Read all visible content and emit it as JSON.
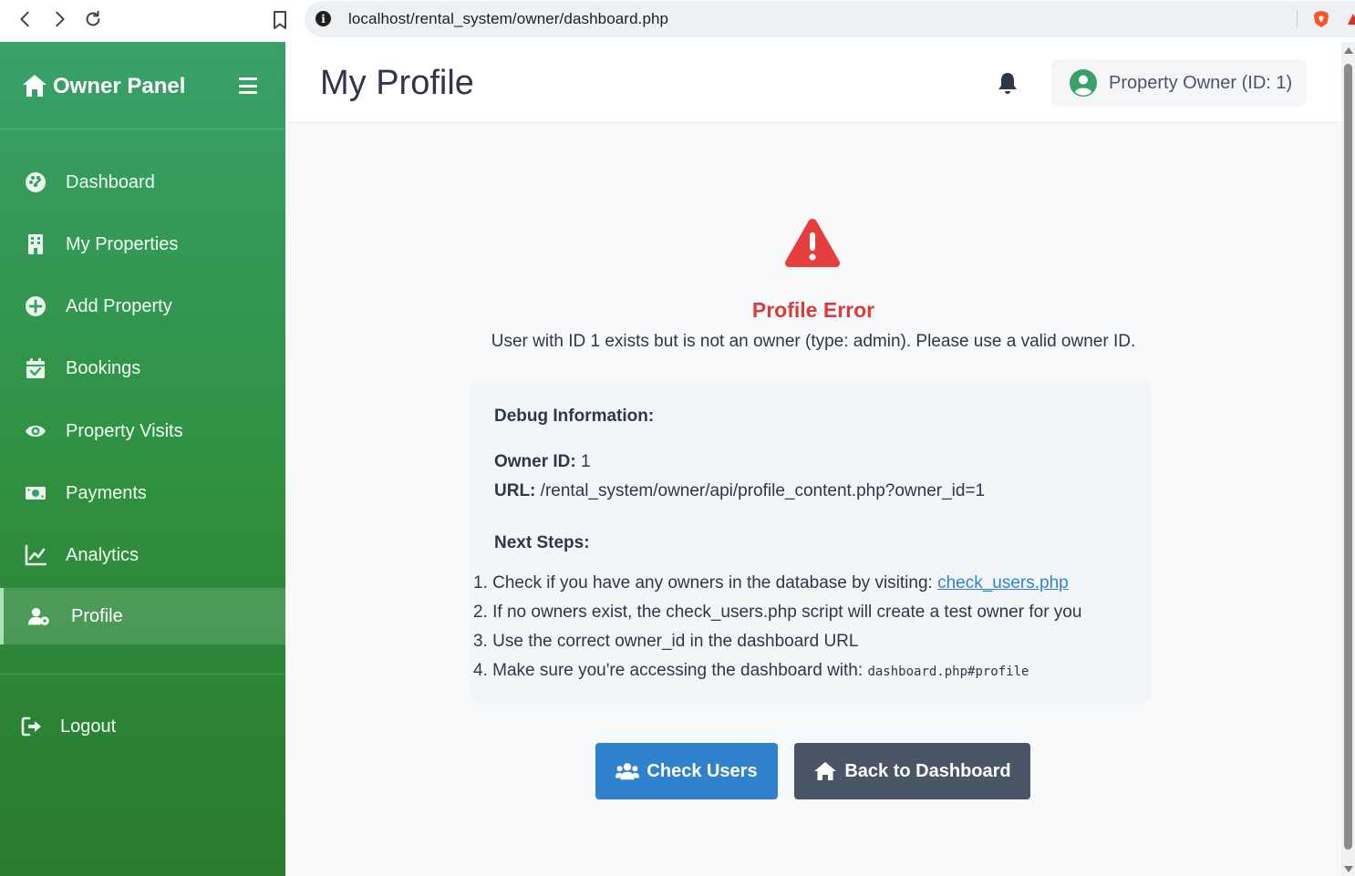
{
  "browser": {
    "url": "localhost/rental_system/owner/dashboard.php"
  },
  "sidebar": {
    "brand": "Owner Panel",
    "items": [
      {
        "label": "Dashboard",
        "icon": "palette-icon"
      },
      {
        "label": "My Properties",
        "icon": "building-icon"
      },
      {
        "label": "Add Property",
        "icon": "plus-circle-icon"
      },
      {
        "label": "Bookings",
        "icon": "calendar-check-icon"
      },
      {
        "label": "Property Visits",
        "icon": "eye-icon"
      },
      {
        "label": "Payments",
        "icon": "money-bill-icon"
      },
      {
        "label": "Analytics",
        "icon": "chart-line-icon"
      },
      {
        "label": "Profile",
        "icon": "user-cog-icon",
        "active": true
      }
    ],
    "logout": "Logout"
  },
  "header": {
    "title": "My Profile",
    "user_label": "Property Owner (ID: 1)"
  },
  "error": {
    "title": "Profile Error",
    "message": "User with ID 1 exists but is not an owner (type: admin). Please use a valid owner ID."
  },
  "debug": {
    "heading": "Debug Information:",
    "owner_id_label": "Owner ID:",
    "owner_id_value": "1",
    "url_label": "URL:",
    "url_value": "/rental_system/owner/api/profile_content.php?owner_id=1",
    "next_steps_heading": "Next Steps:",
    "steps": [
      {
        "num": "1.",
        "text": "Check if you have any owners in the database by visiting: ",
        "link": "check_users.php"
      },
      {
        "num": "2.",
        "text": "If no owners exist, the check_users.php script will create a test owner for you"
      },
      {
        "num": "3.",
        "text": "Use the correct owner_id in the dashboard URL"
      },
      {
        "num": "4.",
        "text": "Make sure you're accessing the dashboard with: ",
        "code": "dashboard.php#profile"
      }
    ]
  },
  "buttons": {
    "check_users": "Check Users",
    "back_dashboard": "Back to Dashboard"
  },
  "colors": {
    "sidebar_green": "#38a169",
    "error_red": "#d63d3d",
    "primary_blue": "#3182ce",
    "dark_gray": "#4a5568"
  }
}
